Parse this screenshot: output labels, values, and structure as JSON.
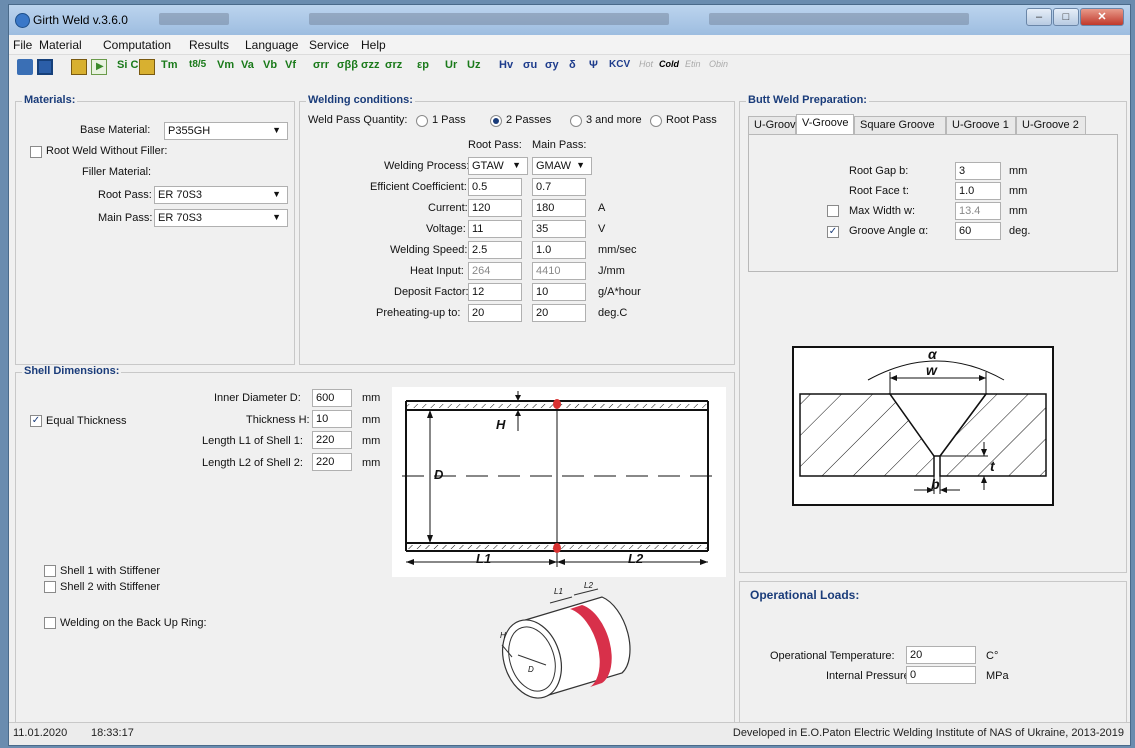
{
  "window": {
    "title": "Girth Weld v.3.6.0"
  },
  "menu": [
    "File",
    "Material",
    "Computation",
    "Results",
    "Language",
    "Service",
    "Help"
  ],
  "toolbar": {
    "buttons": [
      "Si C",
      "Tm",
      "t8/5",
      "Vm",
      "Va",
      "Vb",
      "Vf",
      "σrr",
      "σββ",
      "σzz",
      "σrz",
      "εp",
      "Ur",
      "Uz",
      "Hv",
      "σu",
      "σy",
      "δ",
      "Ψ",
      "KCV"
    ],
    "disabled": [
      "Hot",
      "Cold",
      "Etin",
      "Obin"
    ]
  },
  "materials": {
    "title": "Materials:",
    "base_material_label": "Base Material:",
    "base_material": "P355GH",
    "root_without_filler": "Root Weld Without Filler:",
    "filler_label": "Filler Material:",
    "root_pass_label": "Root Pass:",
    "root_pass": "ER 70S3",
    "main_pass_label": "Main Pass:",
    "main_pass": "ER 70S3"
  },
  "welding": {
    "title": "Welding conditions:",
    "pass_qty_label": "Weld Pass Quantity:",
    "passes": [
      "1 Pass",
      "2 Passes",
      "3 and more",
      "Root Pass"
    ],
    "col_root": "Root Pass:",
    "col_main": "Main Pass:",
    "rows": [
      {
        "label": "Welding Process:",
        "root": "GTAW",
        "main": "GMAW",
        "unit": ""
      },
      {
        "label": "Efficient Coefficient:",
        "root": "0.5",
        "main": "0.7",
        "unit": ""
      },
      {
        "label": "Current:",
        "root": "120",
        "main": "180",
        "unit": "A"
      },
      {
        "label": "Voltage:",
        "root": "11",
        "main": "35",
        "unit": "V"
      },
      {
        "label": "Welding Speed:",
        "root": "2.5",
        "main": "1.0",
        "unit": "mm/sec"
      },
      {
        "label": "Heat Input:",
        "root": "264",
        "main": "4410",
        "unit": "J/mm"
      },
      {
        "label": "Deposit Factor:",
        "root": "12",
        "main": "10",
        "unit": "g/A*hour"
      },
      {
        "label": "Preheating-up to:",
        "root": "20",
        "main": "20",
        "unit": "deg.C"
      }
    ]
  },
  "butt": {
    "title": "Butt Weld Preparation:",
    "tabs": [
      "U-Groove",
      "V-Groove",
      "Square Groove",
      "U-Groove 1",
      "U-Groove 2"
    ],
    "root_gap_label": "Root Gap b:",
    "root_gap": "3",
    "root_gap_unit": "mm",
    "root_face_label": "Root Face t:",
    "root_face": "1.0",
    "root_face_unit": "mm",
    "max_width_label": "Max Width w:",
    "max_width": "13.4",
    "max_width_unit": "mm",
    "groove_angle_label": "Groove Angle α:",
    "groove_angle": "60",
    "groove_angle_unit": "deg.",
    "diagram_labels": {
      "alpha": "α",
      "w": "w",
      "t": "t",
      "b": "b"
    }
  },
  "shell": {
    "title": "Shell Dimensions:",
    "equal_thickness": "Equal Thickness",
    "inner_d_label": "Inner Diameter  D:",
    "inner_d": "600",
    "thickness_label": "Thickness H:",
    "thickness": "10",
    "l1_label": "Length L1 of Shell 1:",
    "l1": "220",
    "l2_label": "Length L2 of Shell 2:",
    "l2": "220",
    "unit": "mm",
    "stiff1": "Shell 1 with Stiffener",
    "stiff2": "Shell 2 with Stiffener",
    "backup": "Welding on the Back Up Ring:",
    "diagram_labels": {
      "H": "H",
      "D": "D",
      "L1": "L1",
      "L2": "L2"
    }
  },
  "loads": {
    "title": "Operational Loads:",
    "temp_label": "Operational Temperature:",
    "temp": "20",
    "temp_unit": "C°",
    "pressure_label": "Internal Pressure:",
    "pressure": "0",
    "pressure_unit": "MPa"
  },
  "status": {
    "date": "11.01.2020",
    "time": "18:33:17",
    "credit": "Developed in E.O.Paton Electric Welding Institute of NAS of Ukraine, 2013-2019"
  }
}
